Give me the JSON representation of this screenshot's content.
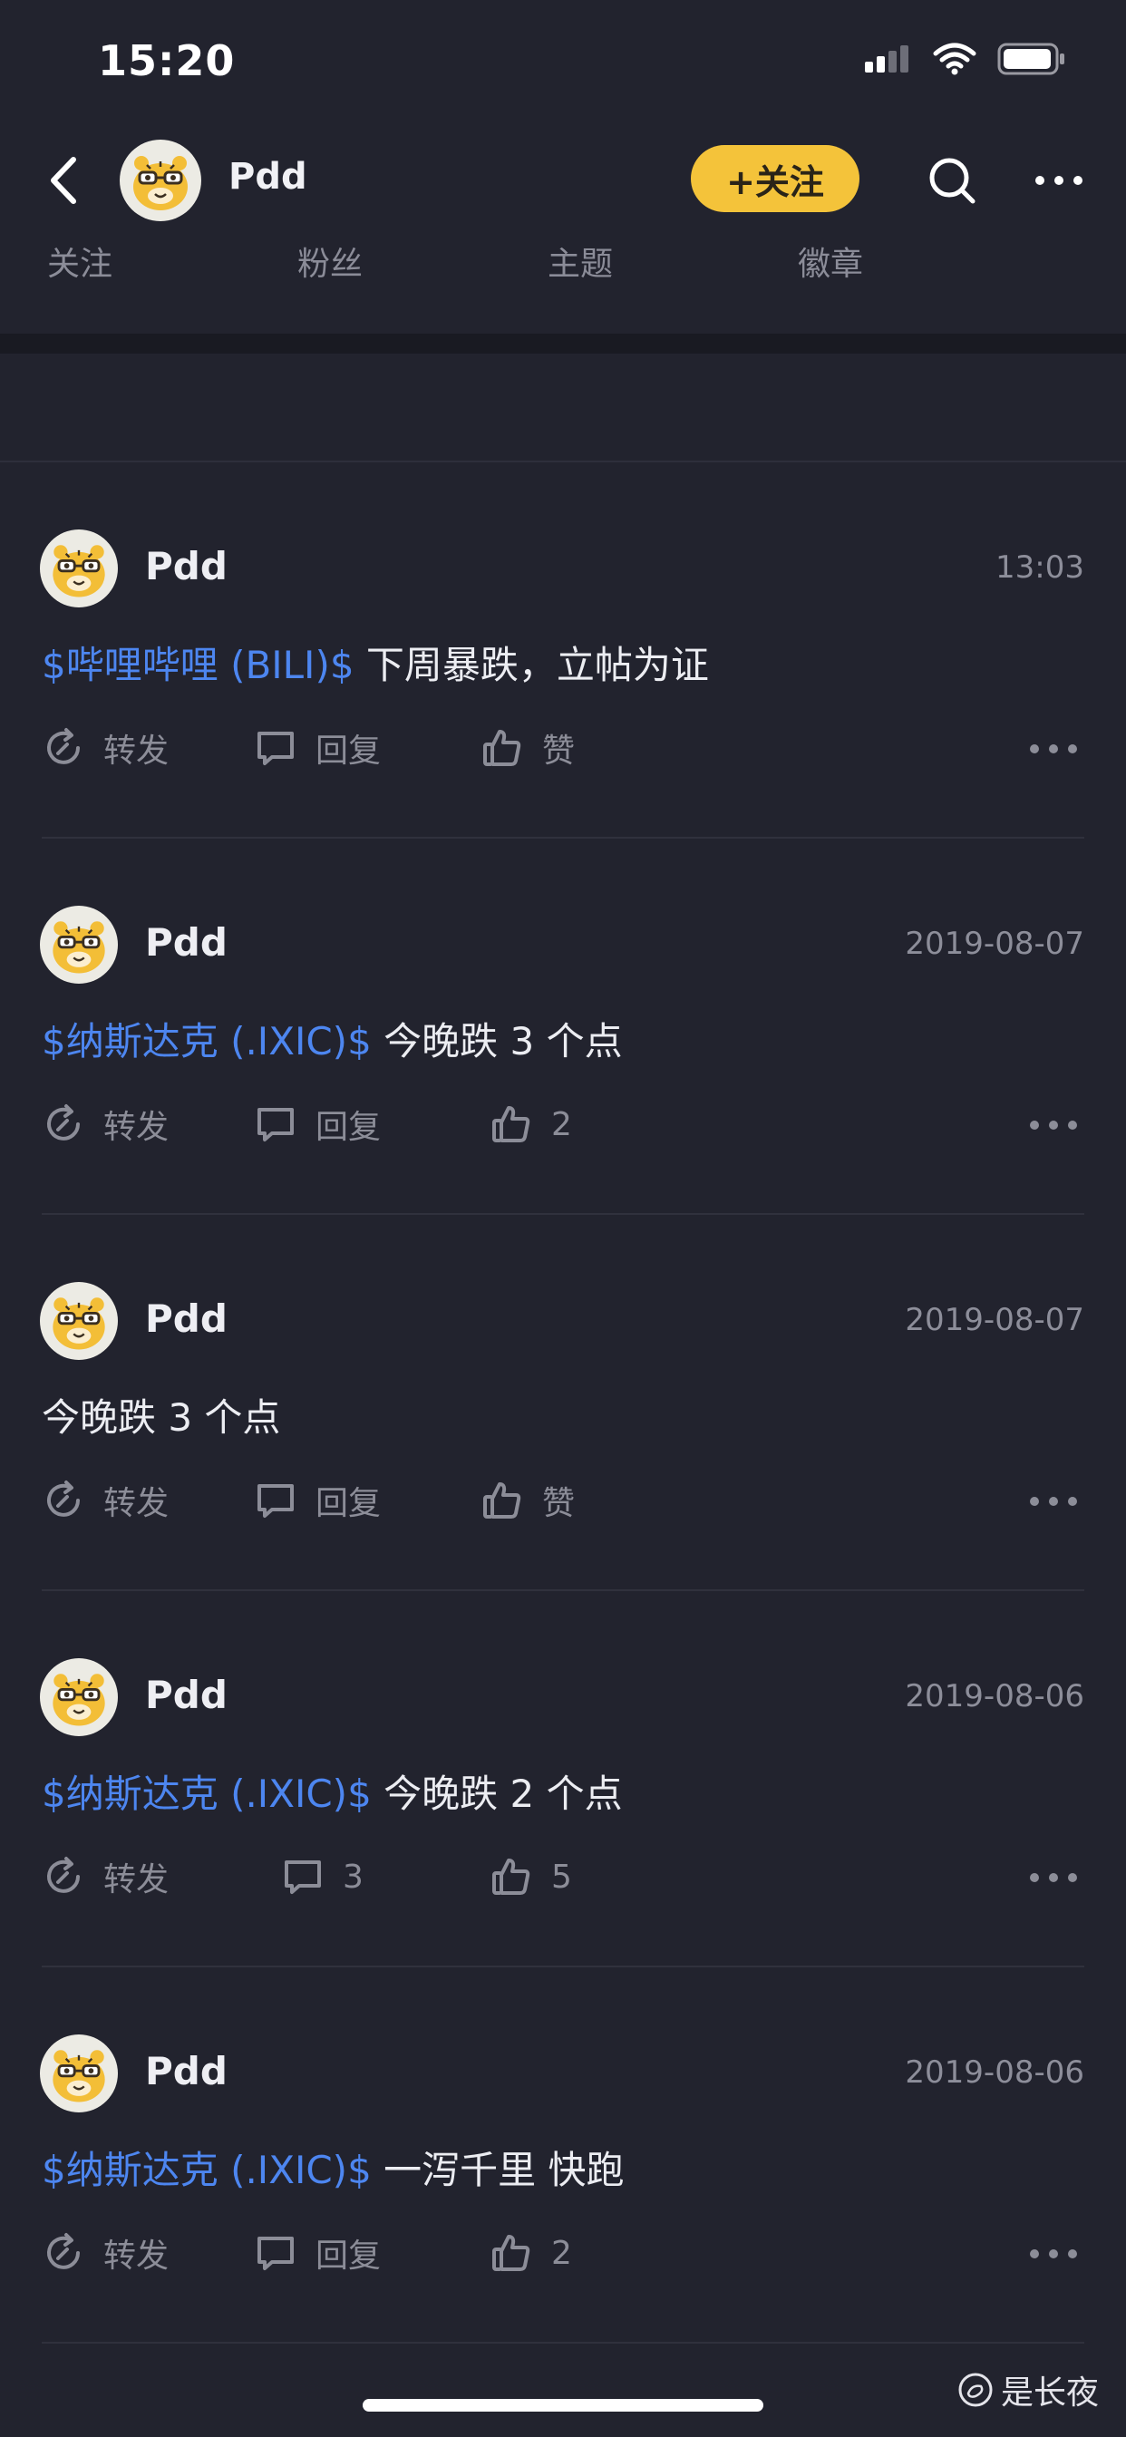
{
  "status_bar": {
    "time": "15:20"
  },
  "header": {
    "profile_name": "Pdd",
    "follow_label": "+关注",
    "stats": [
      "关注",
      "粉丝",
      "主题",
      "徽章"
    ]
  },
  "colors": {
    "background": "#22232e",
    "accent_yellow": "#f4c33a",
    "stock_link": "#4d86f0",
    "muted_text": "#8c8d98"
  },
  "posts": [
    {
      "author": "Pdd",
      "time": "13:03",
      "stock_tag": "$哔哩哔哩 (BILI)$",
      "text": " 下周暴跌，立帖为证",
      "repost_label": "转发",
      "reply_label": "回复",
      "like_label": "赞"
    },
    {
      "author": "Pdd",
      "time": "2019-08-07",
      "stock_tag": "$纳斯达克 (.IXIC)$",
      "text": " 今晚跌 3 个点",
      "repost_label": "转发",
      "reply_label": "回复",
      "like_label": "2"
    },
    {
      "author": "Pdd",
      "time": "2019-08-07",
      "stock_tag": "",
      "text": "今晚跌 3 个点",
      "repost_label": "转发",
      "reply_label": "回复",
      "like_label": "赞"
    },
    {
      "author": "Pdd",
      "time": "2019-08-06",
      "stock_tag": "$纳斯达克 (.IXIC)$",
      "text": " 今晚跌 2 个点",
      "repost_label": "转发",
      "reply_label": "3",
      "like_label": "5"
    },
    {
      "author": "Pdd",
      "time": "2019-08-06",
      "stock_tag": "$纳斯达克 (.IXIC)$",
      "text": " 一泻千里 快跑",
      "repost_label": "转发",
      "reply_label": "回复",
      "like_label": "2"
    }
  ],
  "watermark": "是长夜",
  "icons": [
    "signal-icon",
    "wifi-icon",
    "battery-icon",
    "back-arrow-icon",
    "tiger-avatar",
    "search-icon",
    "more-dots-icon",
    "repost-icon",
    "comment-icon",
    "thumb-up-icon"
  ]
}
